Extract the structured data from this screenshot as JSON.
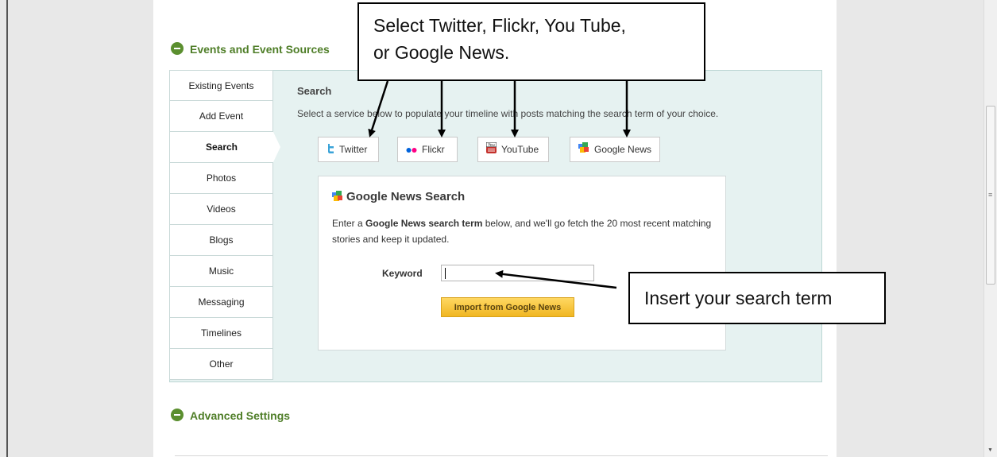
{
  "sections": {
    "events_title": "Events and Event Sources",
    "advanced_title": "Advanced Settings"
  },
  "tabs": [
    {
      "label": "Existing Events"
    },
    {
      "label": "Add Event"
    },
    {
      "label": "Search",
      "active": true
    },
    {
      "label": "Photos"
    },
    {
      "label": "Videos"
    },
    {
      "label": "Blogs"
    },
    {
      "label": "Music"
    },
    {
      "label": "Messaging"
    },
    {
      "label": "Timelines"
    },
    {
      "label": "Other"
    }
  ],
  "search": {
    "heading": "Search",
    "description": "Select a service below to populate your timeline with posts matching the search term of your choice."
  },
  "services": [
    {
      "label": "Twitter",
      "icon": "twitter-icon"
    },
    {
      "label": "Flickr",
      "icon": "flickr-icon"
    },
    {
      "label": "YouTube",
      "icon": "youtube-icon"
    },
    {
      "label": "Google News",
      "icon": "google-news-icon"
    }
  ],
  "google_news": {
    "title": "Google News Search",
    "desc_pre": "Enter a ",
    "desc_bold": "Google News search term",
    "desc_post": " below, and we'll go fetch the 20 most recent matching stories and keep it updated.",
    "keyword_label": "Keyword",
    "keyword_value": "",
    "import_button": "Import from Google News"
  },
  "annotations": {
    "top_line1": "Select Twitter, Flickr, You Tube,",
    "top_line2": "or Google News.",
    "right": "Insert your search term"
  },
  "colors": {
    "section_green": "#4f7e28",
    "panel_bg": "#e6f2f1",
    "button_yellow": "#f5c53a"
  }
}
